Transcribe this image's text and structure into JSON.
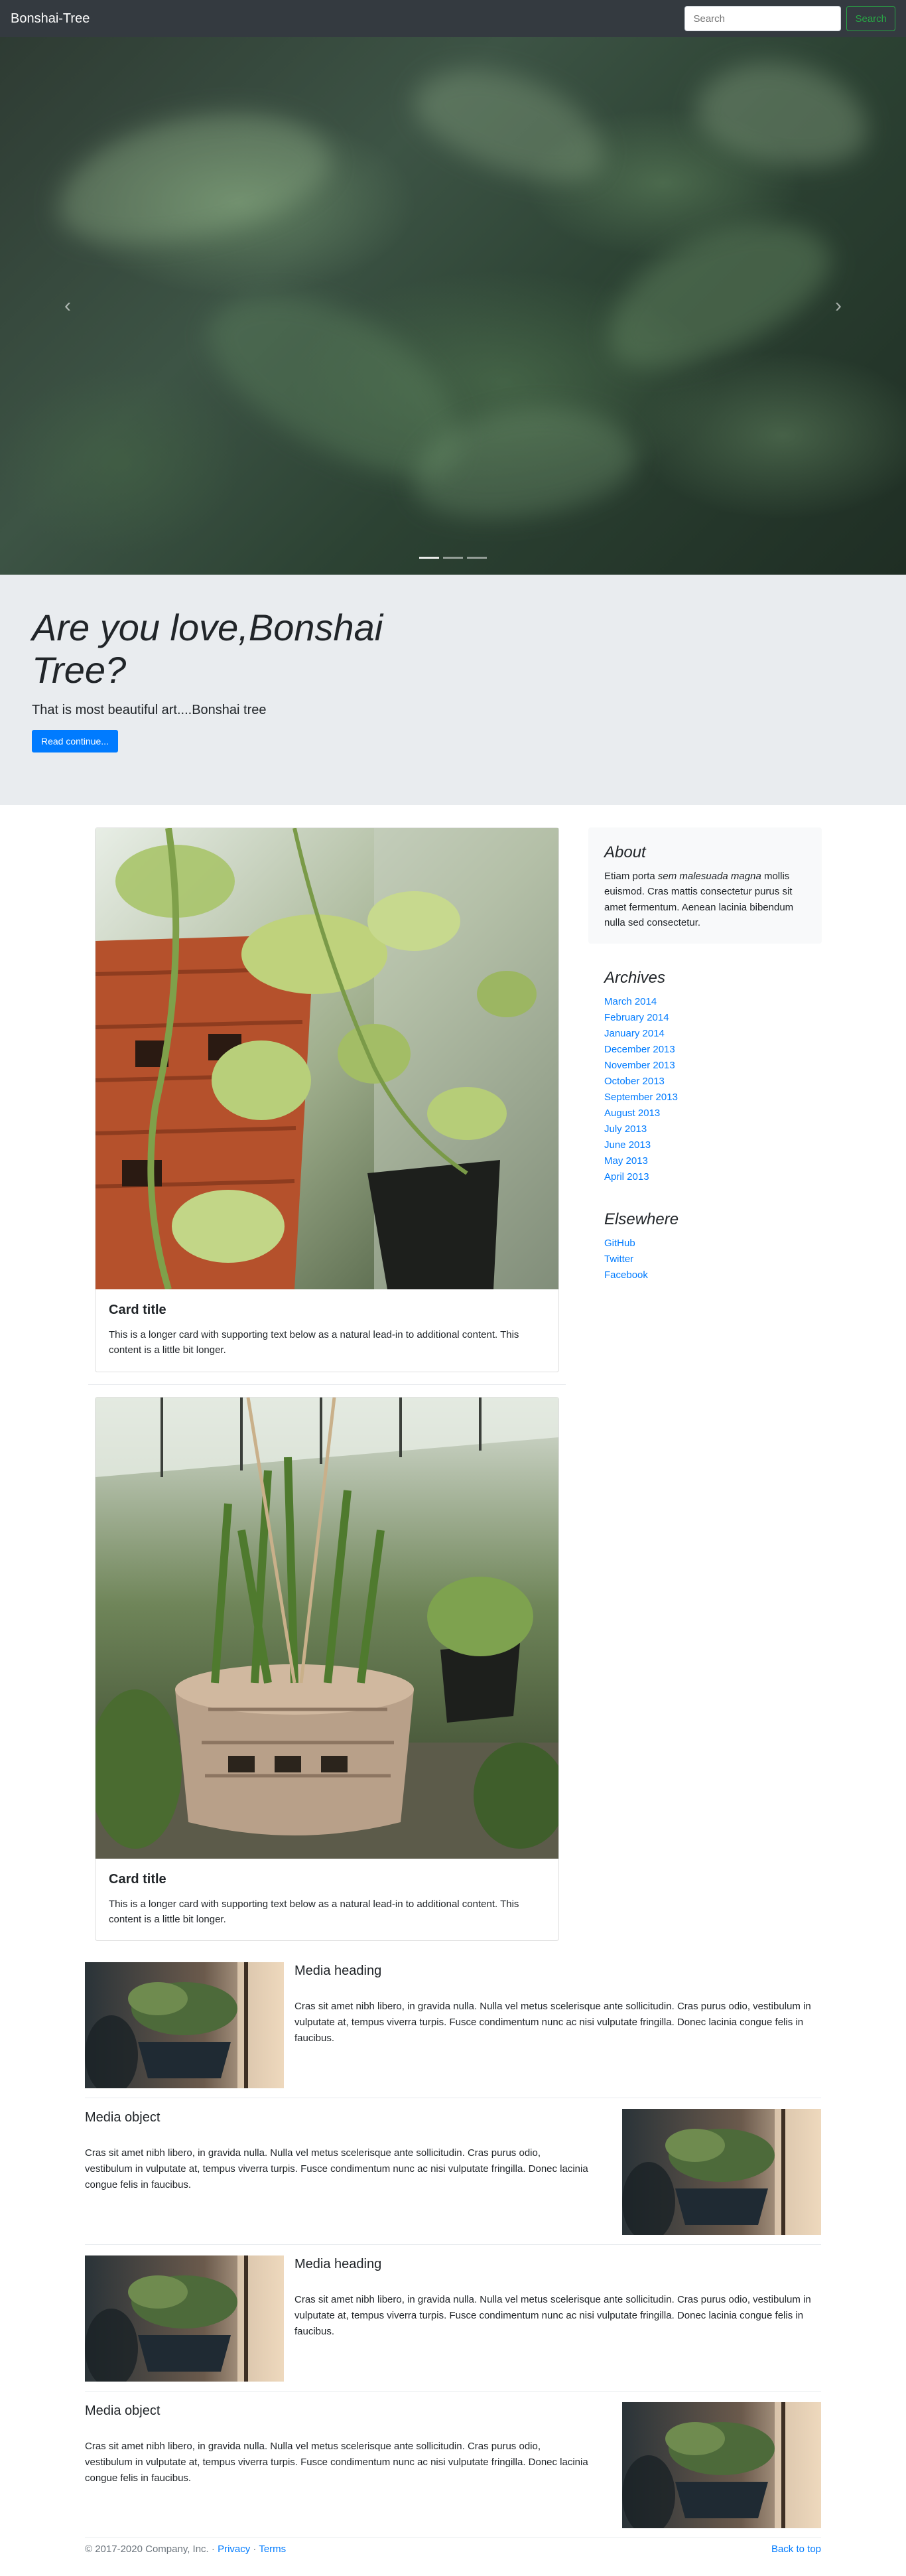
{
  "navbar": {
    "brand": "Bonshai-Tree",
    "search_placeholder": "Search",
    "search_button": "Search"
  },
  "carousel": {
    "prev_icon": "chevron-left-icon",
    "next_icon": "chevron-right-icon",
    "slides_count": 3,
    "active_slide": 1
  },
  "jumbotron": {
    "heading": "Are you love,Bonshai Tree?",
    "lead": "That is most beautiful art....Bonshai tree",
    "button": "Read continue..."
  },
  "cards": [
    {
      "title": "Card title",
      "text": "This is a longer card with supporting text below as a natural lead-in to additional content. This content is a little bit longer."
    },
    {
      "title": "Card title",
      "text": "This is a longer card with supporting text below as a natural lead-in to additional content. This content is a little bit longer."
    }
  ],
  "sidebar": {
    "about": {
      "heading": "About",
      "text_before": "Etiam porta ",
      "text_em": "sem malesuada magna",
      "text_after": " mollis euismod. Cras mattis consectetur purus sit amet fermentum. Aenean lacinia bibendum nulla sed consectetur."
    },
    "archives": {
      "heading": "Archives",
      "items": [
        "March 2014",
        "February 2014",
        "January 2014",
        "December 2013",
        "November 2013",
        "October 2013",
        "September 2013",
        "August 2013",
        "July 2013",
        "June 2013",
        "May 2013",
        "April 2013"
      ]
    },
    "elsewhere": {
      "heading": "Elsewhere",
      "items": [
        "GitHub",
        "Twitter",
        "Facebook"
      ]
    }
  },
  "media": [
    {
      "heading": "Media heading",
      "text": "Cras sit amet nibh libero, in gravida nulla. Nulla vel metus scelerisque ante sollicitudin. Cras purus odio, vestibulum in vulputate at, tempus viverra turpis. Fusce condimentum nunc ac nisi vulputate fringilla. Donec lacinia congue felis in faucibus."
    },
    {
      "heading": "Media object",
      "text": "Cras sit amet nibh libero, in gravida nulla. Nulla vel metus scelerisque ante sollicitudin. Cras purus odio, vestibulum in vulputate at, tempus viverra turpis. Fusce condimentum nunc ac nisi vulputate fringilla. Donec lacinia congue felis in faucibus."
    },
    {
      "heading": "Media heading",
      "text": "Cras sit amet nibh libero, in gravida nulla. Nulla vel metus scelerisque ante sollicitudin. Cras purus odio, vestibulum in vulputate at, tempus viverra turpis. Fusce condimentum nunc ac nisi vulputate fringilla. Donec lacinia congue felis in faucibus."
    },
    {
      "heading": "Media object",
      "text": "Cras sit amet nibh libero, in gravida nulla. Nulla vel metus scelerisque ante sollicitudin. Cras purus odio, vestibulum in vulputate at, tempus viverra turpis. Fusce condimentum nunc ac nisi vulputate fringilla. Donec lacinia congue felis in faucibus."
    }
  ],
  "footer": {
    "copyright": "© 2017-2020 Company, Inc. ·",
    "privacy": "Privacy",
    "separator": "·",
    "terms": "Terms",
    "back_to_top": "Back to top"
  },
  "colors": {
    "navbar_bg": "#343a40",
    "primary": "#007bff",
    "success": "#28a745",
    "jumbotron_bg": "#e9ecef"
  }
}
